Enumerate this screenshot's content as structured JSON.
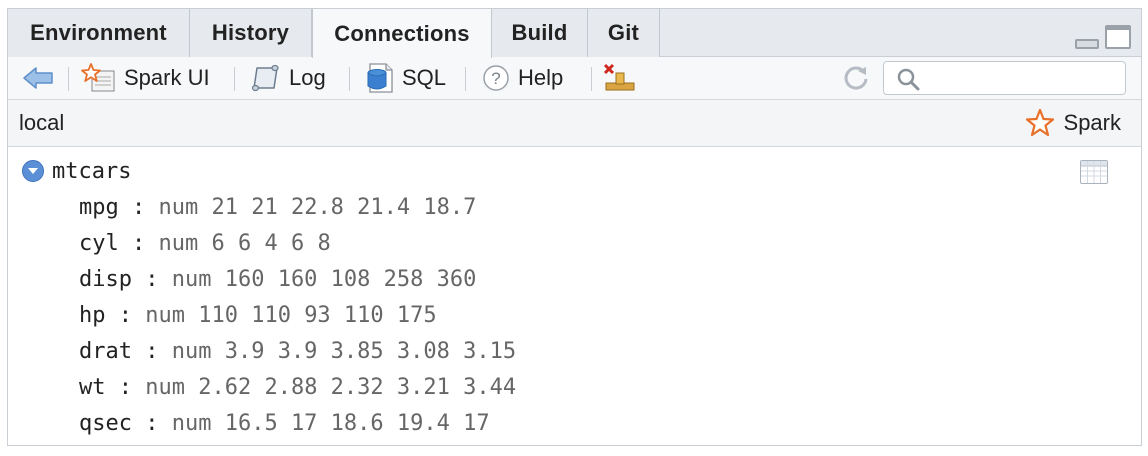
{
  "tabs": [
    {
      "label": "Environment",
      "active": false
    },
    {
      "label": "History",
      "active": false
    },
    {
      "label": "Connections",
      "active": true
    },
    {
      "label": "Build",
      "active": false
    },
    {
      "label": "Git",
      "active": false
    }
  ],
  "toolbar": {
    "back_icon": "back-arrow-icon",
    "spark_ui_label": "Spark UI",
    "log_label": "Log",
    "sql_label": "SQL",
    "help_label": "Help",
    "disconnect_icon": "disconnect-icon",
    "refresh_icon": "refresh-icon",
    "search_placeholder": "",
    "search_value": ""
  },
  "connection": {
    "name": "local",
    "type_label": "Spark"
  },
  "tree": {
    "table_name": "mtcars",
    "fields": [
      {
        "name": "mpg",
        "sep": " : ",
        "type": "num 21 21 22.8 21.4 18.7"
      },
      {
        "name": "cyl",
        "sep": " : ",
        "type": "num 6 6 4 6 8"
      },
      {
        "name": "disp",
        "sep": " : ",
        "type": "num 160 160 108 258 360"
      },
      {
        "name": "hp",
        "sep": " : ",
        "type": "num 110 110 93 110 175"
      },
      {
        "name": "drat",
        "sep": " : ",
        "type": "num 3.9 3.9 3.85 3.08 3.15"
      },
      {
        "name": "wt",
        "sep": " : ",
        "type": "num 2.62 2.88 2.32 3.21 3.44"
      },
      {
        "name": "qsec",
        "sep": " : ",
        "type": "num 16.5 17 18.6 19.4 17"
      }
    ]
  },
  "colors": {
    "accent_blue": "#5b8fd6",
    "spark_orange": "#e8702a"
  }
}
